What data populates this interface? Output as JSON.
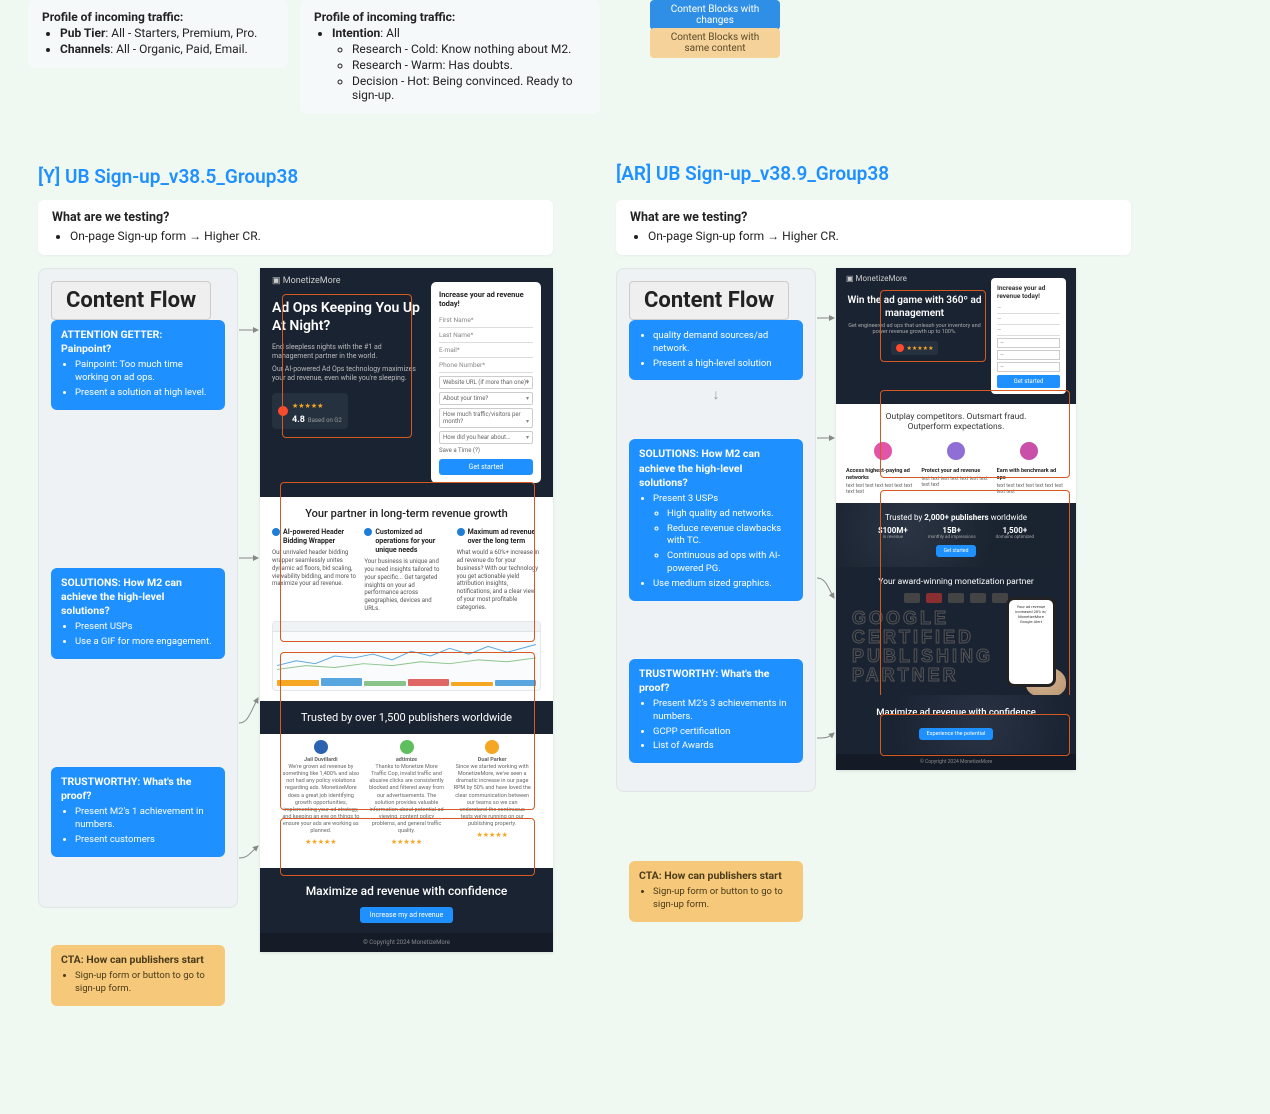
{
  "top_profiles": {
    "left": {
      "heading": "Profile of incoming traffic:",
      "items": [
        {
          "bold": "Pub Tier",
          "rest": ": All - Starters, Premium, Pro."
        },
        {
          "bold": "Channels",
          "rest": ": All - Organic, Paid, Email."
        }
      ]
    },
    "right": {
      "heading": "Profile of incoming traffic:",
      "intention_label": "Intention",
      "intention_rest": ": All",
      "subitems": [
        "Research - Cold: Know nothing about M2.",
        "Research - Warm: Has doubts.",
        "Decision - Hot: Being convinced.  Ready to sign-up."
      ]
    }
  },
  "legend": {
    "blue": "Content Blocks with changes",
    "orange": "Content Blocks with same content"
  },
  "variant_y": {
    "title": "[Y] UB Sign-up_v38.5_Group38",
    "testing_heading": "What are we testing?",
    "testing_items": [
      "On-page Sign-up form → Higher CR."
    ],
    "content_flow_label": "Content Flow",
    "cards": {
      "attention": {
        "title": "ATTENTION GETTER: Painpoint?",
        "items": [
          "Painpoint: Too much time working on ad ops.",
          "Present a solution at high level."
        ]
      },
      "solutions": {
        "title": "SOLUTIONS: How M2 can achieve the high-level solutions?",
        "items": [
          "Present USPs",
          "Use a GIF for more engagement."
        ]
      },
      "trust": {
        "title": "TRUSTWORTHY: What's the proof?",
        "items": [
          "Present M2's 1 achievement in numbers.",
          "Present customers"
        ]
      },
      "cta": {
        "title": "CTA: How can publishers start",
        "items": [
          "Sign-up form or button to go to sign-up form."
        ]
      }
    },
    "page": {
      "logo": "▣ MonetizeMore",
      "hero_h": "Ad Ops Keeping You Up At Night?",
      "hero_p1": "End sleepless nights with the #1 ad management partner in the world.",
      "hero_p2": "Our AI-powered Ad Ops technology maximizes your ad revenue, even while you're sleeping.",
      "rating_score": "4.8",
      "rating_sub": "Based on G2",
      "form_title": "Increase your ad revenue today!",
      "form_fields": [
        "First Name*",
        "Last Name*",
        "E-mail*",
        "Phone Number*"
      ],
      "form_selects": [
        "Website URL (if more than one)*",
        "About your time?",
        "How much traffic/visitors per month?",
        "How did you hear about…"
      ],
      "form_check": "Save a Time (?)",
      "form_btn": "Get started",
      "partner_title": "Your partner in long-term revenue growth",
      "cols": [
        {
          "head": "AI-powered Header Bidding Wrapper",
          "body": "Our unrivaled header bidding wrapper seamlessly unites dynamic ad floors, bid scaling, viewability bidding, and more to maximize your ad revenue."
        },
        {
          "head": "Customized ad operations for your unique needs",
          "body": "Your business is unique and you need insights tailored to your specific... Get targeted insights on your ad performance across geographies, devices and URLs."
        },
        {
          "head": "Maximum ad revenue over the long term",
          "body": "What would a 60%+ increase in ad revenue do for your business? With our technology you get actionable yield attribution insights, notifications, and a clear view of your most profitable categories."
        }
      ],
      "trusted": "Trusted by over 1,500 publishers worldwide",
      "pubs": [
        "Jail Duvillardi",
        "adtimize",
        "Dual Parker"
      ],
      "cta_big": "Maximize ad revenue with confidence",
      "cta_btn": "Increase my ad revenue",
      "copy": "© Copyright 2024 MonetizeMore"
    }
  },
  "variant_ar": {
    "title": "[AR] UB Sign-up_v38.9_Group38",
    "testing_heading": "What are we testing?",
    "testing_items": [
      "On-page Sign-up form → Higher CR."
    ],
    "content_flow_label": "Content Flow",
    "cards": {
      "attention": {
        "items": [
          "quality demand sources/ad network.",
          "Present a high-level solution"
        ]
      },
      "solutions": {
        "title": "SOLUTIONS: How M2 can achieve the high-level solutions?",
        "items": [
          "Present 3 USPs",
          "High quality ad networks.",
          "Reduce revenue clawbacks with TC.",
          "Continuous ad ops with AI-powered PG.",
          "Use medium sized graphics."
        ]
      },
      "trust": {
        "title": "TRUSTWORTHY: What's the proof?",
        "items": [
          "Present M2's 3 achievements in numbers.",
          "GCPP certification",
          "List of Awards"
        ]
      },
      "cta": {
        "title": "CTA: How can publishers start",
        "items": [
          "Sign-up form or button to go to sign-up form."
        ]
      }
    },
    "page": {
      "logo": "▣ MonetizeMore",
      "hero_h": "Win the ad game with 360º ad management",
      "hero_sub": "Get engineered ad ops that unleash your inventory and power revenue growth up to 100%.",
      "form_title": "Increase your ad revenue today!",
      "outplay_l1": "Outplay competitors. Outsmart fraud.",
      "outplay_l2": "Outperform expectations.",
      "tcols": [
        {
          "head": "Access highest-paying ad networks"
        },
        {
          "head": "Protect your ad revenue"
        },
        {
          "head": "Earn with benchmark ad ops"
        }
      ],
      "trusted2_pre": "Trusted by ",
      "trusted2_bold": "2,000+ publishers",
      "trusted2_post": " worldwide",
      "stats": [
        {
          "v": "$100M+",
          "l": "in revenue"
        },
        {
          "v": "15B+",
          "l": "monthly ad impressions"
        },
        {
          "v": "1,500+",
          "l": "domains optimized"
        }
      ],
      "stat_btn": "Get started",
      "award_title": "Your award-winning monetization partner",
      "gcpp_l1": "GOOGLE",
      "gcpp_l2": "CERTIFIED",
      "gcpp_l3": "PUBLISHING",
      "gcpp_l4": "PARTNER",
      "phone_text": "Your ad revenue increased 28% w/ MonetizeMore Google Alert",
      "conf": "Maximize ad revenue with confidence",
      "conf_btn": "Experience the potential",
      "copy": "© Copyright 2024 MonetizeMore"
    }
  }
}
